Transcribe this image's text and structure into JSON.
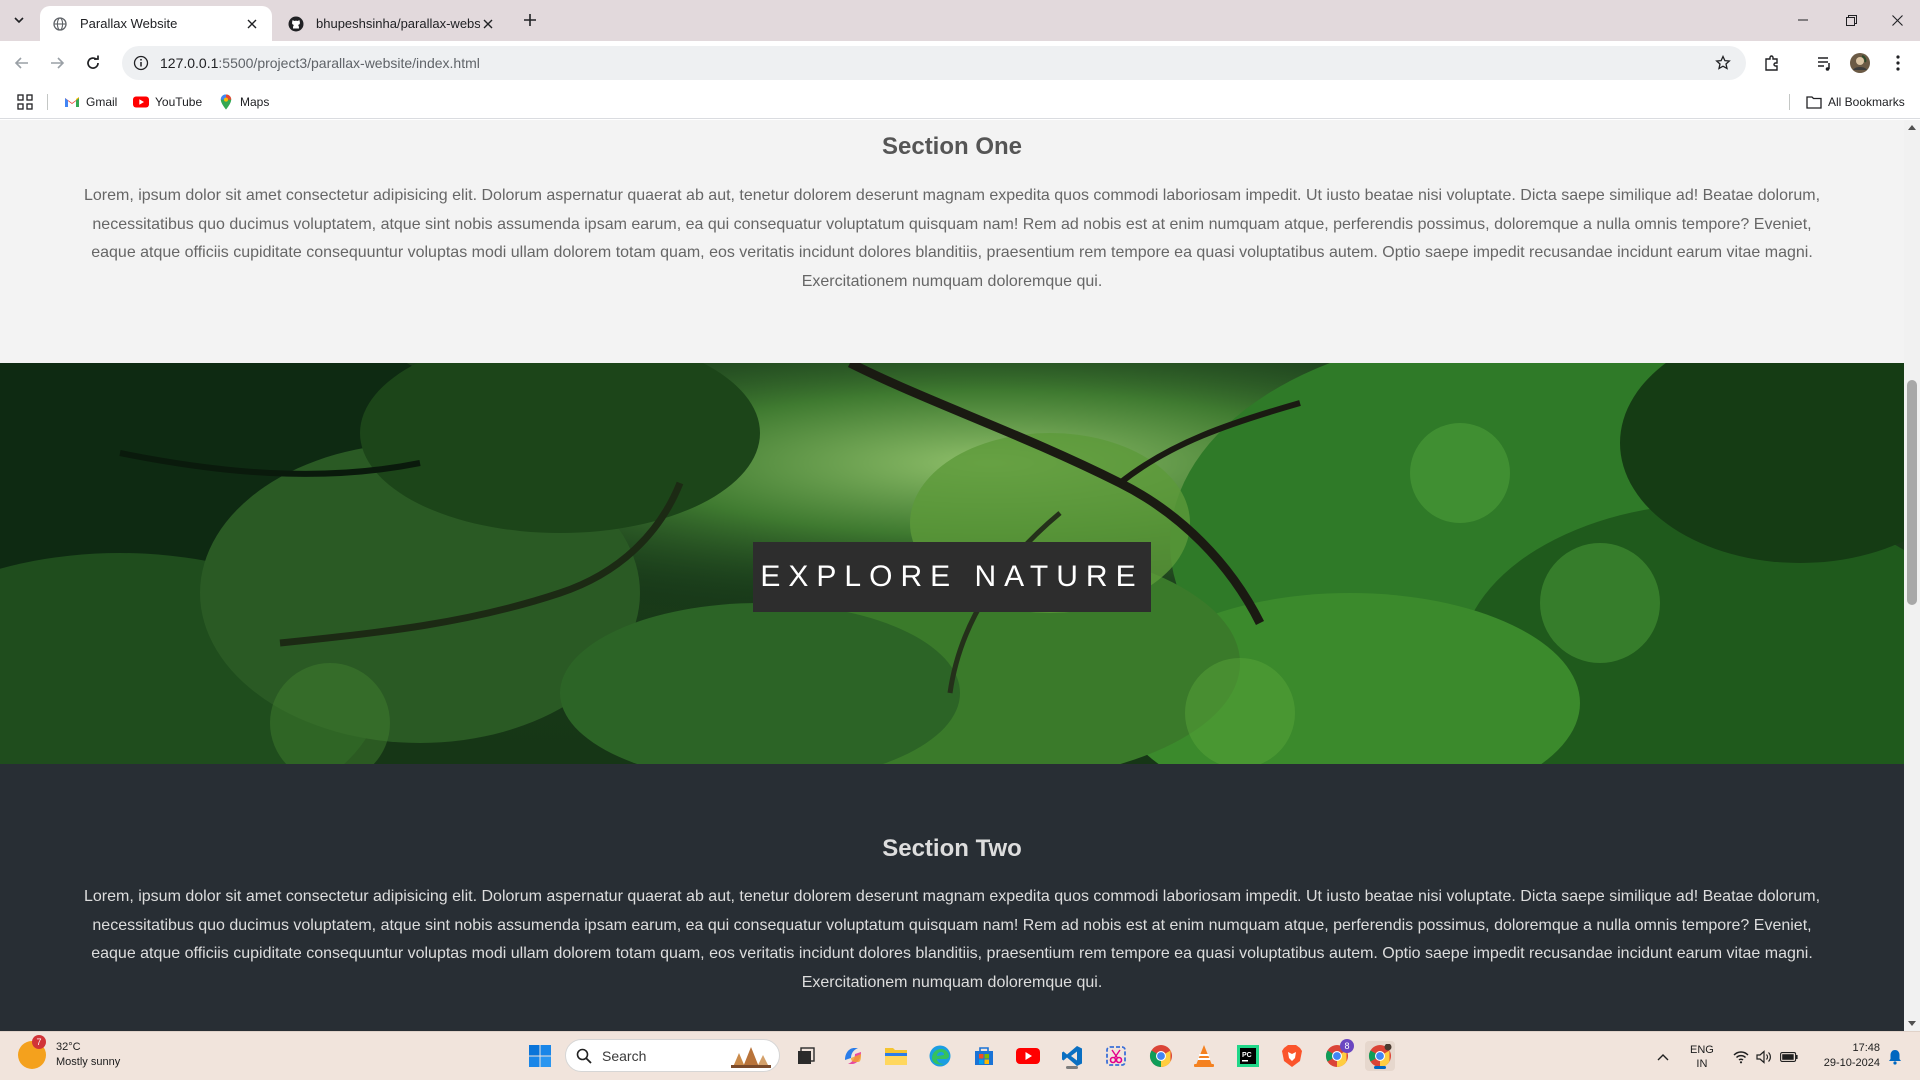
{
  "browser": {
    "tabs": [
      {
        "title": "Parallax Website",
        "active": true
      },
      {
        "title": "bhupeshsinha/parallax-website",
        "active": false
      }
    ],
    "url_host": "127.0.0.1",
    "url_path": ":5500/project3/parallax-website/index.html",
    "bookmarks": [
      {
        "label": "Gmail",
        "icon": "gmail-icon"
      },
      {
        "label": "YouTube",
        "icon": "youtube-icon"
      },
      {
        "label": "Maps",
        "icon": "maps-icon"
      }
    ],
    "all_bookmarks_label": "All Bookmarks"
  },
  "page": {
    "section_one": {
      "heading": "Section One",
      "body": "Lorem, ipsum dolor sit amet consectetur adipisicing elit. Dolorum aspernatur quaerat ab aut, tenetur dolorem deserunt magnam expedita quos commodi laboriosam impedit. Ut iusto beatae nisi voluptate. Dicta saepe similique ad! Beatae dolorum, necessitatibus quo ducimus voluptatem, atque sint nobis assumenda ipsam earum, ea qui consequatur voluptatum quisquam nam! Rem ad nobis est at enim numquam atque, perferendis possimus, doloremque a nulla omnis tempore? Eveniet, eaque atque officiis cupiditate consequuntur voluptas modi ullam dolorem totam quam, eos veritatis incidunt dolores blanditiis, praesentium rem tempore ea quasi voluptatibus autem. Optio saepe impedit recusandae incidunt earum vitae magni. Exercitationem numquam doloremque qui."
    },
    "parallax_caption": "EXPLORE NATURE",
    "section_two": {
      "heading": "Section Two",
      "body": "Lorem, ipsum dolor sit amet consectetur adipisicing elit. Dolorum aspernatur quaerat ab aut, tenetur dolorem deserunt magnam expedita quos commodi laboriosam impedit. Ut iusto beatae nisi voluptate. Dicta saepe similique ad! Beatae dolorum, necessitatibus quo ducimus voluptatem, atque sint nobis assumenda ipsam earum, ea qui consequatur voluptatum quisquam nam! Rem ad nobis est at enim numquam atque, perferendis possimus, doloremque a nulla omnis tempore? Eveniet, eaque atque officiis cupiditate consequuntur voluptas modi ullam dolorem totam quam, eos veritatis incidunt dolores blanditiis, praesentium rem tempore ea quasi voluptatibus autem. Optio saepe impedit recusandae incidunt earum vitae magni. Exercitationem numquam doloremque qui."
    }
  },
  "taskbar": {
    "weather_temp": "32°C",
    "weather_desc": "Mostly sunny",
    "weather_badge": "7",
    "search_label": "Search",
    "lang_line1": "ENG",
    "lang_line2": "IN",
    "time": "17:48",
    "date": "29-10-2024",
    "chrome_badge": "8",
    "icons": [
      "windows-start-icon",
      "task-view-icon",
      "copilot-icon",
      "file-explorer-icon",
      "edge-icon",
      "microsoft-store-icon",
      "youtube-app-icon",
      "vscode-icon",
      "snipping-tool-icon",
      "chrome-icon",
      "vlc-icon",
      "pycharm-icon",
      "brave-icon",
      "chrome-profile-icon",
      "chrome-active-icon"
    ]
  },
  "colors": {
    "tabstrip": "#e2d9dc",
    "section_light_bg": "#f3f3f3",
    "section_dark_bg": "#282e34",
    "caption_bg": "#2d2d2d",
    "taskbar": "#f1e4dc"
  }
}
